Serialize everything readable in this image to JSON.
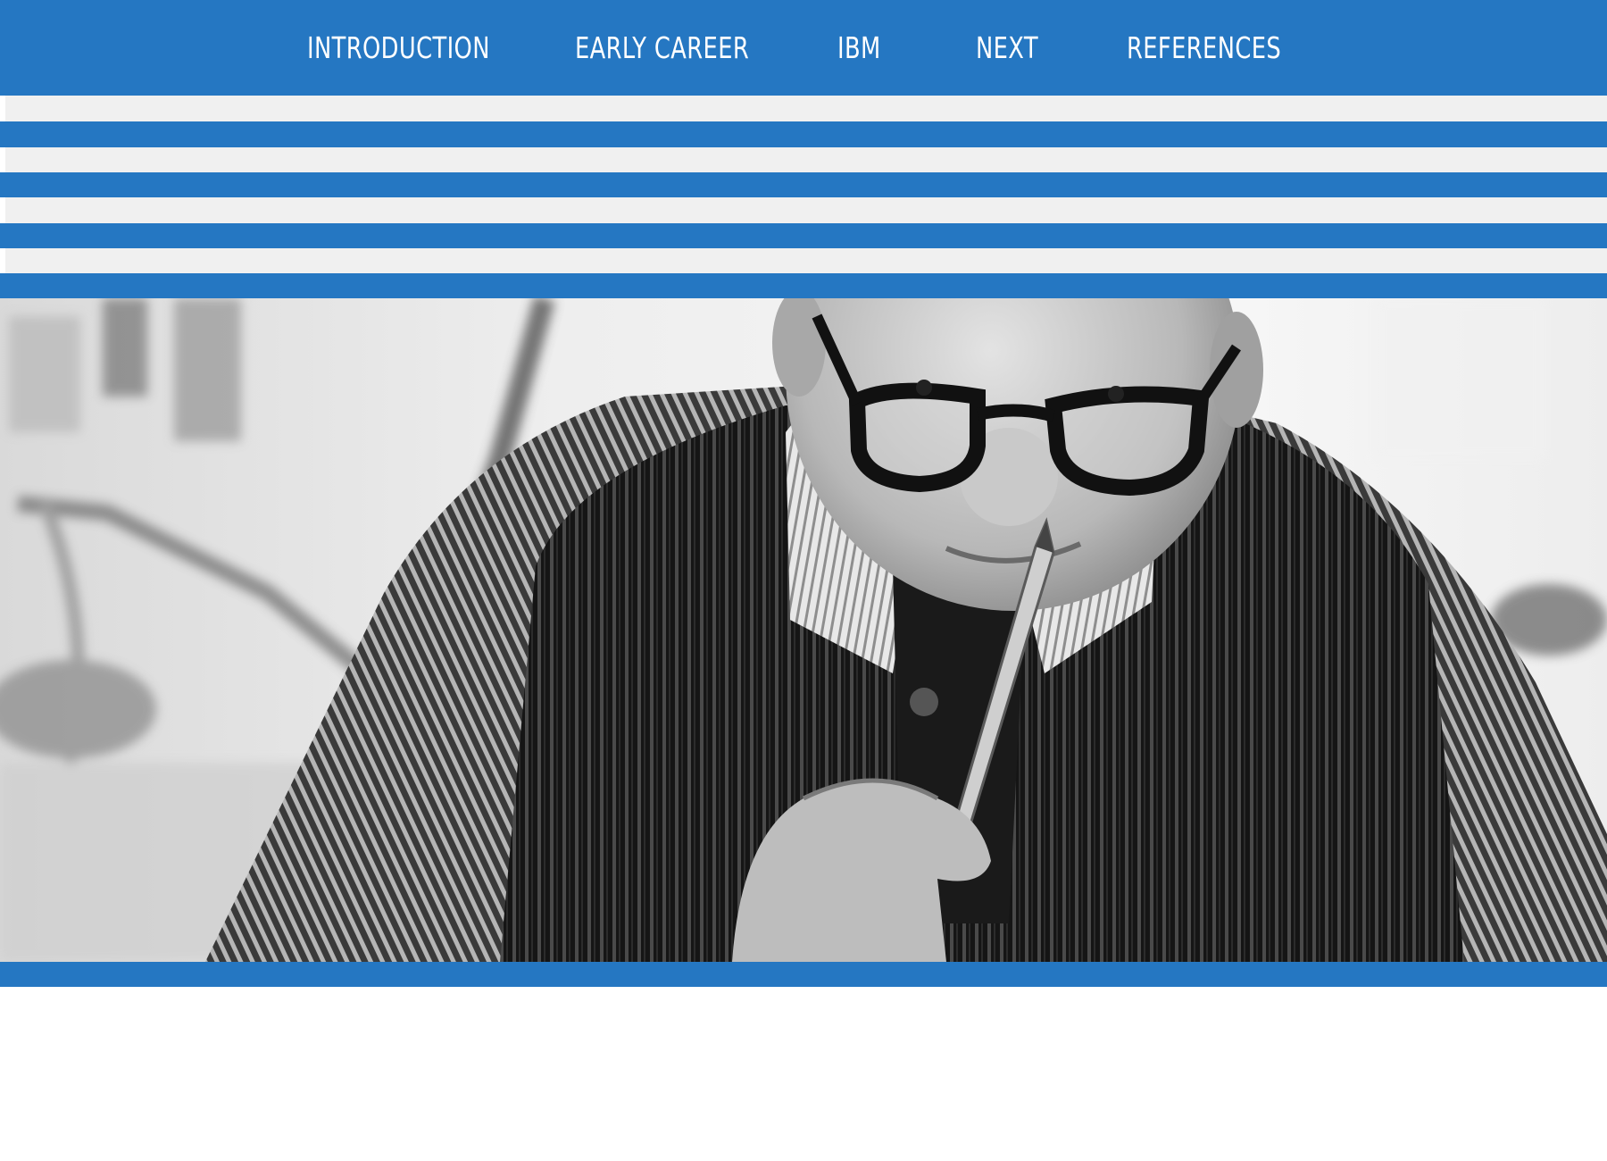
{
  "nav": {
    "items": [
      {
        "label": "INTRODUCTION"
      },
      {
        "label": "EARLY CAREER"
      },
      {
        "label": "IBM"
      },
      {
        "label": "NEXT"
      },
      {
        "label": "REFERENCES"
      }
    ]
  },
  "colors": {
    "accent": "#2577c2",
    "stripe_light": "#f0f0f0",
    "background": "#ffffff"
  },
  "hero": {
    "image": "black-and-white-portrait-man-glasses-pencil"
  }
}
